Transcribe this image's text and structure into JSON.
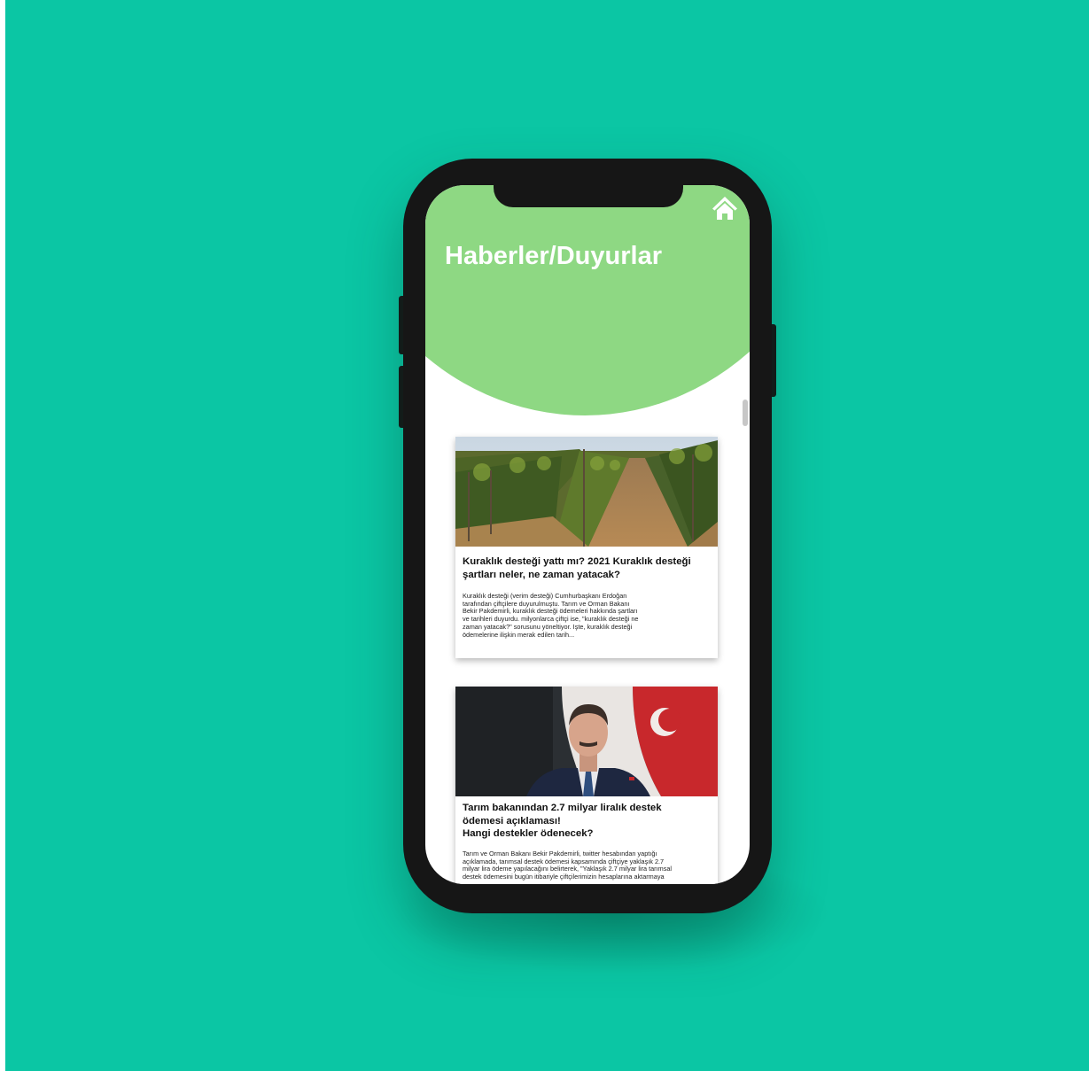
{
  "page": {
    "title": "Haberler/Duyurlar",
    "home_icon": "home-icon"
  },
  "colors": {
    "background": "#0bc6a4",
    "header": "#8ed883",
    "phone_frame": "#161616"
  },
  "news": [
    {
      "image": "vineyard-photo",
      "title_lines": [
        "Kuraklık desteği yattı mı? 2021 Kuraklık desteği",
        "şartları neler, ne zaman yatacak?"
      ],
      "summary_lines": [
        "Kuraklık desteği (verim desteği) Cumhurbaşkanı Erdoğan",
        "tarafından çiftçilere duyurulmuştu. Tarım ve Orman Bakanı",
        "Bekir Pakdemirli, kuraklık desteği ödemeleri hakkında şartları",
        "ve tarihleri duyurdu. milyonlarca çiftçi ise, \"kuraklık desteği ne",
        "zaman yatacak?\" sorusunu yöneltiyor. İşte, kuraklık desteği",
        "ödemelerine ilişkin merak edilen tarih..."
      ]
    },
    {
      "image": "minister-photo",
      "title_lines": [
        "Tarım bakanından 2.7 milyar liralık destek",
        "ödemesi açıklaması!",
        "Hangi destekler ödenecek?"
      ],
      "summary_lines": [
        "Tarım ve Orman Bakanı Bekir Pakdemirli, twitter hesabından yaptığı",
        "açıklamada, tarımsal destek ödemesi kapsamında çiftçiye yaklaşık 2.7",
        "milyar lira ödeme yapılacağını belirterek, \"Yaklaşık 2.7 milyar lira tarımsal",
        "destek ödemesini bugün itibariyle çiftçilerimizin hesaplarına aktarmaya"
      ]
    }
  ]
}
